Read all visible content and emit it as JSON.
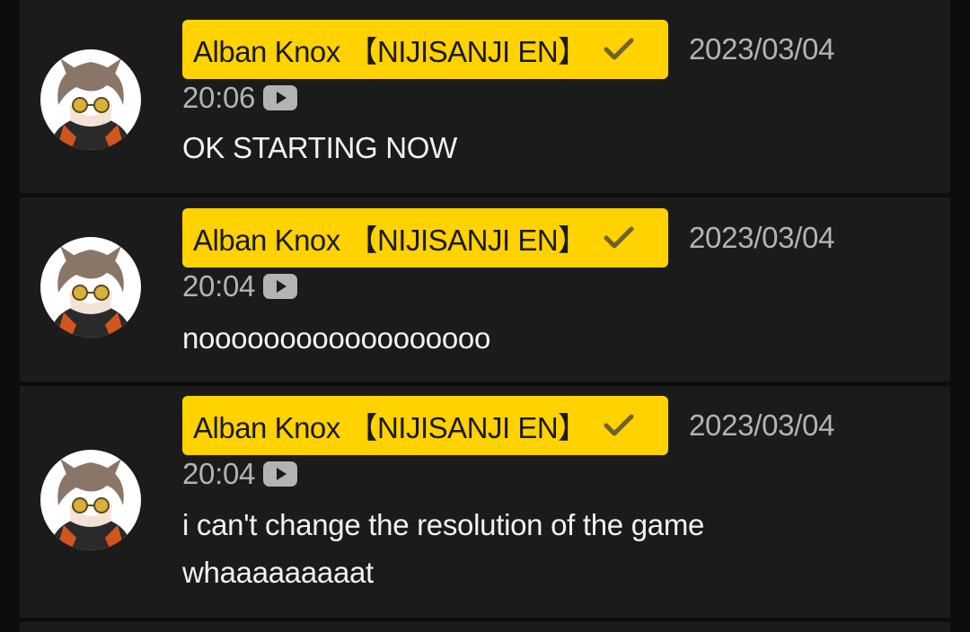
{
  "messages": [
    {
      "author": "Alban Knox 【NIJISANJI EN】",
      "date": "2023/03/04",
      "time": "20:06",
      "text": "OK STARTING NOW"
    },
    {
      "author": "Alban Knox 【NIJISANJI EN】",
      "date": "2023/03/04",
      "time": "20:04",
      "text": "noooooooooooooooooo"
    },
    {
      "author": "Alban Knox 【NIJISANJI EN】",
      "date": "2023/03/04",
      "time": "20:04",
      "text": "i can't change the resolution of the game whaaaaaaaaat"
    }
  ],
  "colors": {
    "badge": "#ffd200",
    "card": "#1b1b1b",
    "background": "#0d0d0d",
    "meta_text": "#b3b3b3",
    "message_text": "#f2f2f2"
  },
  "icons": {
    "verified": "check-icon",
    "source": "youtube-icon"
  }
}
